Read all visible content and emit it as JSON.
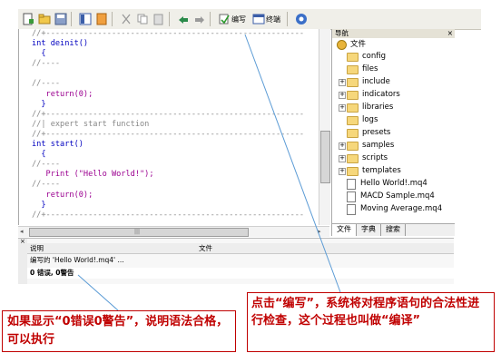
{
  "toolbar": {
    "compile_label": "编写",
    "compile_tooltip": "编写",
    "debug_label": "终端",
    "icons": [
      "new-file-icon",
      "open-folder-icon",
      "save-icon",
      "toggle-navigator-icon",
      "toggle-toolbox-icon",
      "cut-icon",
      "copy-icon",
      "paste-icon",
      "undo-icon",
      "redo-icon",
      "compile-icon",
      "terminal-icon",
      "help-icon"
    ]
  },
  "editor": {
    "lines": [
      {
        "text": "//+-------------------------------------------------------",
        "color": "#888888"
      },
      {
        "text": "int deinit()",
        "color": "#0000c0"
      },
      {
        "text": "  {",
        "color": "#0000c0"
      },
      {
        "text": "//----",
        "color": "#888888"
      },
      {
        "text": "",
        "color": "#000000"
      },
      {
        "text": "//----",
        "color": "#888888"
      },
      {
        "text": "   return(0);",
        "color": "#9b0090"
      },
      {
        "text": "  }",
        "color": "#0000c0"
      },
      {
        "text": "//+-------------------------------------------------------",
        "color": "#888888"
      },
      {
        "text": "//| expert start function",
        "color": "#888888"
      },
      {
        "text": "//+-------------------------------------------------------",
        "color": "#888888"
      },
      {
        "text": "int start()",
        "color": "#0000c0"
      },
      {
        "text": "  {",
        "color": "#0000c0"
      },
      {
        "text": "//----",
        "color": "#888888"
      },
      {
        "text": "   Print (\"Hello World!\");",
        "color": "#9b0090"
      },
      {
        "text": "//----",
        "color": "#888888"
      },
      {
        "text": "   return(0);",
        "color": "#9b0090"
      },
      {
        "text": "  }",
        "color": "#0000c0"
      },
      {
        "text": "//+-------------------------------------------------------",
        "color": "#888888"
      }
    ]
  },
  "navigator": {
    "title": "导航",
    "close": "×",
    "root_label": "文件",
    "items": [
      {
        "label": "config",
        "kind": "folder",
        "expandable": false
      },
      {
        "label": "files",
        "kind": "folder",
        "expandable": false
      },
      {
        "label": "include",
        "kind": "folder",
        "expandable": true
      },
      {
        "label": "indicators",
        "kind": "folder",
        "expandable": true
      },
      {
        "label": "libraries",
        "kind": "folder",
        "expandable": true
      },
      {
        "label": "logs",
        "kind": "folder",
        "expandable": false
      },
      {
        "label": "presets",
        "kind": "folder",
        "expandable": false
      },
      {
        "label": "samples",
        "kind": "folder",
        "expandable": true
      },
      {
        "label": "scripts",
        "kind": "folder",
        "expandable": true
      },
      {
        "label": "templates",
        "kind": "folder",
        "expandable": true
      },
      {
        "label": "Hello World!.mq4",
        "kind": "file",
        "expandable": false
      },
      {
        "label": "MACD Sample.mq4",
        "kind": "file",
        "expandable": false
      },
      {
        "label": "Moving Average.mq4",
        "kind": "file",
        "expandable": false
      }
    ],
    "tabs": [
      "文件",
      "字典",
      "搜索"
    ]
  },
  "toolbox": {
    "columns": [
      "说明",
      "文件"
    ],
    "rows": [
      {
        "desc": "编写的 'Hello World!.mq4' ...",
        "file": ""
      },
      {
        "desc": "0 错误, 0警告",
        "file": ""
      }
    ]
  },
  "annotations": {
    "right_text": "点击“编写”，系统将对程序语句的合法性进行检查，这个过程也叫做“编译”",
    "left_text": "如果显示“0错误0警告”，说明语法合格，可以执行"
  },
  "colors": {
    "annotation": "#c00000",
    "connector": "#5b9bd5"
  }
}
